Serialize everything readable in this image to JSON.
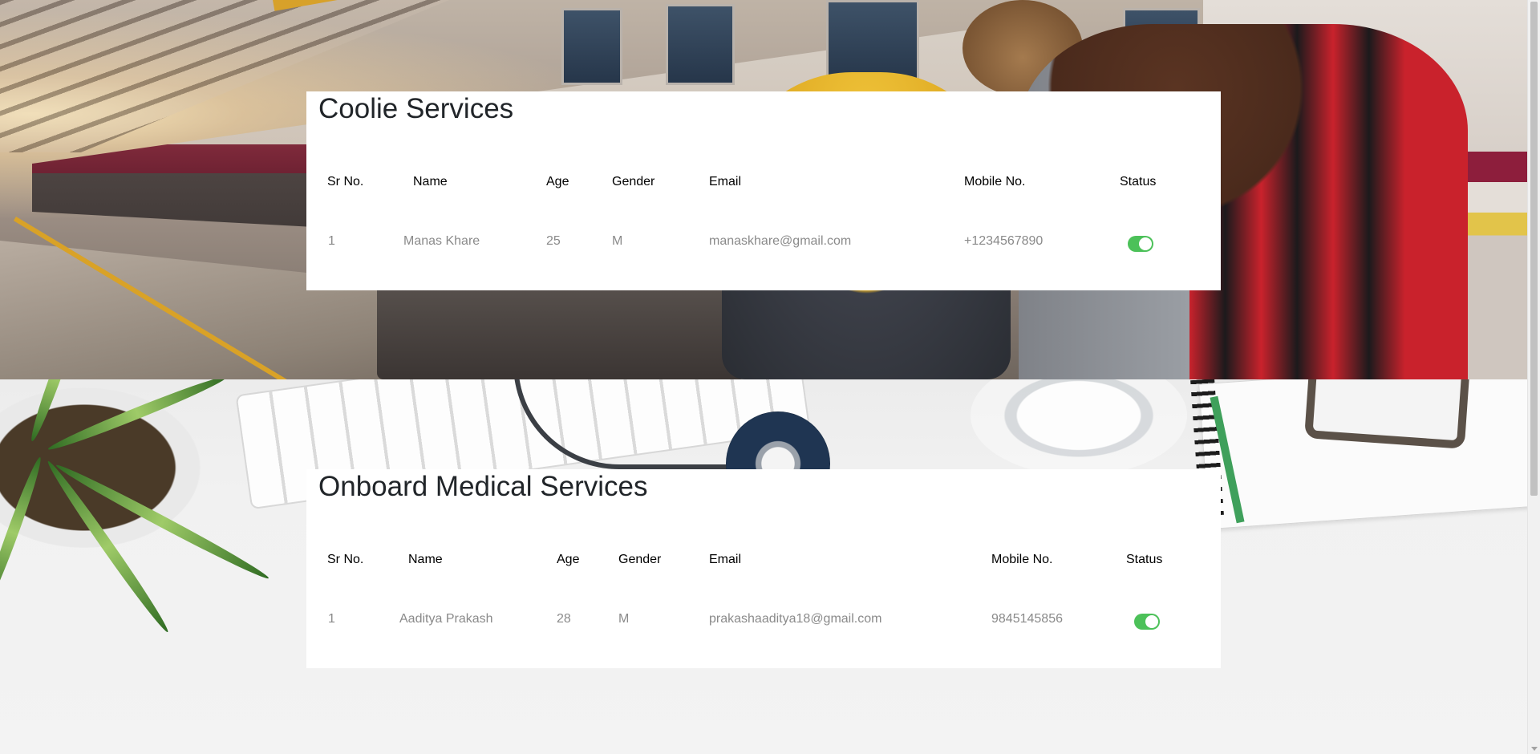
{
  "sections": [
    {
      "title": "Coolie Services",
      "headers": {
        "sr_no": "Sr No.",
        "name": "Name",
        "age": "Age",
        "gender": "Gender",
        "email": "Email",
        "mobile": "Mobile No.",
        "status": "Status"
      },
      "rows": [
        {
          "sr_no": "1",
          "name": "Manas Khare",
          "age": "25",
          "gender": "M",
          "email": "manaskhare@gmail.com",
          "mobile": "+1234567890",
          "status_on": true
        }
      ]
    },
    {
      "title": "Onboard Medical Services",
      "headers": {
        "sr_no": "Sr No.",
        "name": "Name",
        "age": "Age",
        "gender": "Gender",
        "email": "Email",
        "mobile": "Mobile No.",
        "status": "Status"
      },
      "rows": [
        {
          "sr_no": "1",
          "name": "Aaditya Prakash",
          "age": "28",
          "gender": "M",
          "email": "prakashaaditya18@gmail.com",
          "mobile": "9845145856",
          "status_on": true
        }
      ]
    }
  ],
  "colors": {
    "toggle_on": "#4cc159",
    "header_text": "#000000",
    "cell_text": "#8a8a8a",
    "card_bg": "#ffffff"
  }
}
